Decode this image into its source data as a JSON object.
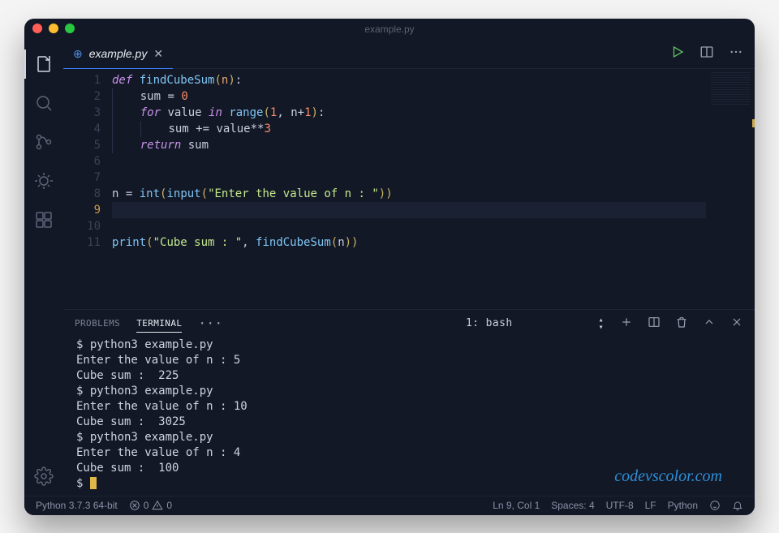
{
  "window": {
    "title": "example.py"
  },
  "tab": {
    "label": "example.py",
    "icon": "python-file-icon"
  },
  "code": {
    "lines": [
      {
        "n": 1,
        "tokens": [
          [
            "kw",
            "def "
          ],
          [
            "fn",
            "findCubeSum"
          ],
          [
            "punc",
            "("
          ],
          [
            "prm",
            "n"
          ],
          [
            "punc",
            ")"
          ],
          [
            "op",
            ":"
          ]
        ]
      },
      {
        "n": 2,
        "indent": 1,
        "tokens": [
          [
            "var",
            "sum"
          ],
          [
            "op",
            " = "
          ],
          [
            "num",
            "0"
          ]
        ]
      },
      {
        "n": 3,
        "indent": 1,
        "tokens": [
          [
            "kw",
            "for "
          ],
          [
            "var",
            "value"
          ],
          [
            "kw",
            " in "
          ],
          [
            "builtin",
            "range"
          ],
          [
            "punc",
            "("
          ],
          [
            "num",
            "1"
          ],
          [
            "op",
            ", "
          ],
          [
            "var",
            "n"
          ],
          [
            "op",
            "+"
          ],
          [
            "num",
            "1"
          ],
          [
            "punc",
            ")"
          ],
          [
            "op",
            ":"
          ]
        ]
      },
      {
        "n": 4,
        "indent": 2,
        "tokens": [
          [
            "var",
            "sum"
          ],
          [
            "op",
            " += "
          ],
          [
            "var",
            "value"
          ],
          [
            "op",
            "**"
          ],
          [
            "num",
            "3"
          ]
        ]
      },
      {
        "n": 5,
        "indent": 1,
        "tokens": [
          [
            "kw",
            "return "
          ],
          [
            "var",
            "sum"
          ]
        ]
      },
      {
        "n": 6,
        "tokens": []
      },
      {
        "n": 7,
        "tokens": []
      },
      {
        "n": 8,
        "tokens": [
          [
            "var",
            "n"
          ],
          [
            "op",
            " = "
          ],
          [
            "builtin",
            "int"
          ],
          [
            "punc",
            "("
          ],
          [
            "builtin",
            "input"
          ],
          [
            "punc",
            "("
          ],
          [
            "str",
            "\"Enter the value of n : \""
          ],
          [
            "punc",
            "))"
          ]
        ]
      },
      {
        "n": 9,
        "current": true,
        "tokens": []
      },
      {
        "n": 10,
        "tokens": [
          [
            "builtin",
            "print"
          ],
          [
            "punc",
            "("
          ],
          [
            "str",
            "\"Cube sum : \""
          ],
          [
            "op",
            ", "
          ],
          [
            "fn",
            "findCubeSum"
          ],
          [
            "punc",
            "("
          ],
          [
            "var",
            "n"
          ],
          [
            "punc",
            "))"
          ]
        ]
      },
      {
        "n": 11,
        "tokens": []
      }
    ]
  },
  "panel": {
    "tabs": {
      "problems": "PROBLEMS",
      "terminal": "TERMINAL"
    },
    "terminal_select": "1: bash"
  },
  "terminal": {
    "lines": [
      "$ python3 example.py",
      "Enter the value of n : 5",
      "Cube sum :  225",
      "$ python3 example.py",
      "Enter the value of n : 10",
      "Cube sum :  3025",
      "$ python3 example.py",
      "Enter the value of n : 4",
      "Cube sum :  100",
      "$ "
    ]
  },
  "status": {
    "python": "Python 3.7.3 64-bit",
    "errors": "0",
    "warnings": "0",
    "cursor": "Ln 9, Col 1",
    "spaces": "Spaces: 4",
    "encoding": "UTF-8",
    "eol": "LF",
    "lang": "Python"
  },
  "watermark": "codevscolor.com"
}
